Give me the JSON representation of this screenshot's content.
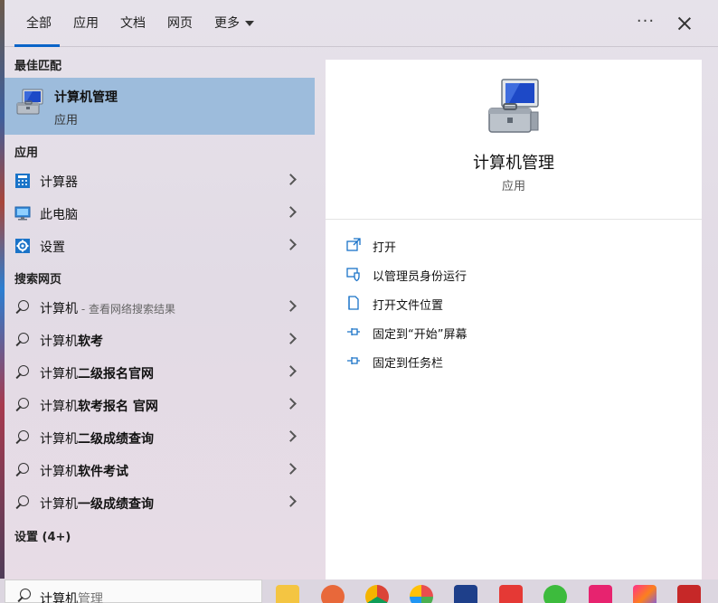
{
  "tabs": [
    {
      "label": "全部",
      "active": true
    },
    {
      "label": "应用"
    },
    {
      "label": "文档"
    },
    {
      "label": "网页"
    },
    {
      "label": "更多"
    }
  ],
  "more_menu_icon": "ellipsis-icon",
  "close_icon": "close-icon",
  "best_match": {
    "header": "最佳匹配",
    "title": "计算机管理",
    "subtitle": "应用",
    "icon": "computer-management-icon"
  },
  "apps": {
    "header": "应用",
    "items": [
      {
        "label": "计算器",
        "icon": "calculator-icon"
      },
      {
        "label": "此电脑",
        "icon": "this-pc-icon"
      },
      {
        "label": "设置",
        "icon": "settings-gear-icon"
      }
    ]
  },
  "web": {
    "header": "搜索网页",
    "items": [
      {
        "label": "计算机",
        "suffix": " - 查看网络搜索结果"
      },
      {
        "label": "计算机软考"
      },
      {
        "label": "计算机二级报名官网"
      },
      {
        "label": "计算机软考报名 官网"
      },
      {
        "label": "计算机二级成绩查询"
      },
      {
        "label": "计算机软件考试"
      },
      {
        "label": "计算机一级成绩查询"
      }
    ]
  },
  "settings_count": "设置 (4+)",
  "detail": {
    "title": "计算机管理",
    "subtitle": "应用",
    "actions": [
      {
        "label": "打开",
        "icon": "open-icon"
      },
      {
        "label": "以管理员身份运行",
        "icon": "run-as-admin-icon"
      },
      {
        "label": "打开文件位置",
        "icon": "file-location-icon"
      },
      {
        "label": "固定到“开始”屏幕",
        "icon": "pin-icon"
      },
      {
        "label": "固定到任务栏",
        "icon": "pin-icon"
      }
    ]
  },
  "search_box": {
    "typed": "计算机",
    "suggestion": "管理"
  },
  "colors": {
    "accent": "#0a64c8",
    "selected_row": "#9dbcdc",
    "icon_blue": "#1a73c8"
  },
  "taskbar_apps": [
    "file-explorer-icon",
    "snail-app-icon",
    "chrome-icon",
    "colorful-app-icon",
    "blue-app-icon",
    "wps-icon",
    "wechat-icon",
    "pink-app-icon",
    "jetbrains-icon",
    "red-app-icon"
  ]
}
